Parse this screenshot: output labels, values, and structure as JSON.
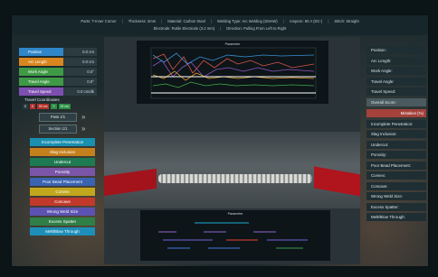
{
  "header": {
    "part": "Parts: T-Inner Corner",
    "thickness": "Thickness: 3mm",
    "material": "Material: Carbon Steel",
    "welding_type": "Welding Type: Arc Welding (SMAW)",
    "ampere": "Ampere: 80 A (DC-)",
    "stitch": "Stitch: Straight",
    "electrode": "Electrode: Rutile Electrode (3.2 mm)",
    "direction": "Direction: Pulling From Left to Right"
  },
  "left_panel": {
    "params": [
      {
        "label": "Position",
        "value": "0.0 cm",
        "color": "#2f86c9"
      },
      {
        "label": "Arc Length",
        "value": "0.0 cm",
        "color": "#d9861f"
      },
      {
        "label": "Work Angle",
        "value": "0.0°",
        "color": "#3f9a45"
      },
      {
        "label": "Travel Angle",
        "value": "0.0°",
        "color": "#3f9a45"
      },
      {
        "label": "Travel Speed",
        "value": "0.0 cm/dk",
        "color": "#7e4fb0"
      }
    ],
    "travel_coordinates": "Travel Coordinates",
    "coords": [
      "0 ",
      "X",
      "00 cm",
      "Y",
      "00 cm"
    ],
    "pass_label": "Pass 1/1",
    "section_label": "Section 1/1",
    "mistakes": [
      {
        "label": "Incomplete Penetration",
        "color": "#1a8fb0"
      },
      {
        "label": "Slag Inclusion",
        "color": "#c4801c"
      },
      {
        "label": "Undercut",
        "color": "#1e7a53"
      },
      {
        "label": "Porosity",
        "color": "#7a55a8"
      },
      {
        "label": "Poor Bead Placement",
        "color": "#3a63b1"
      },
      {
        "label": "Convex",
        "color": "#c2a71e"
      },
      {
        "label": "Concave",
        "color": "#c0392b"
      },
      {
        "label": "Wrong Weld Size",
        "color": "#5b53b3"
      },
      {
        "label": "Excess Spatter",
        "color": "#2f7f47"
      },
      {
        "label": "Melt/Blow Through",
        "color": "#1d8fb8"
      }
    ]
  },
  "graph_top": {
    "title": "Parameter"
  },
  "graph_bottom": {
    "title": "Parameter"
  },
  "right_panel": {
    "labels": [
      "Position:",
      "Arc Length:",
      "Work Angle:",
      "Travel Angle:",
      "Travel Speed:",
      "Overall Score:"
    ],
    "mistakes_header": "Mistakes (%)",
    "mistakes": [
      "Incomplete Penetration:",
      "Slag Inclusion:",
      "Undercut:",
      "Porosity:",
      "Poor Bead Placement:",
      "Convex:",
      "Concave:",
      "Wrong Weld Size:",
      "Excess Spatter:",
      "Melt/Blow Through:"
    ]
  }
}
